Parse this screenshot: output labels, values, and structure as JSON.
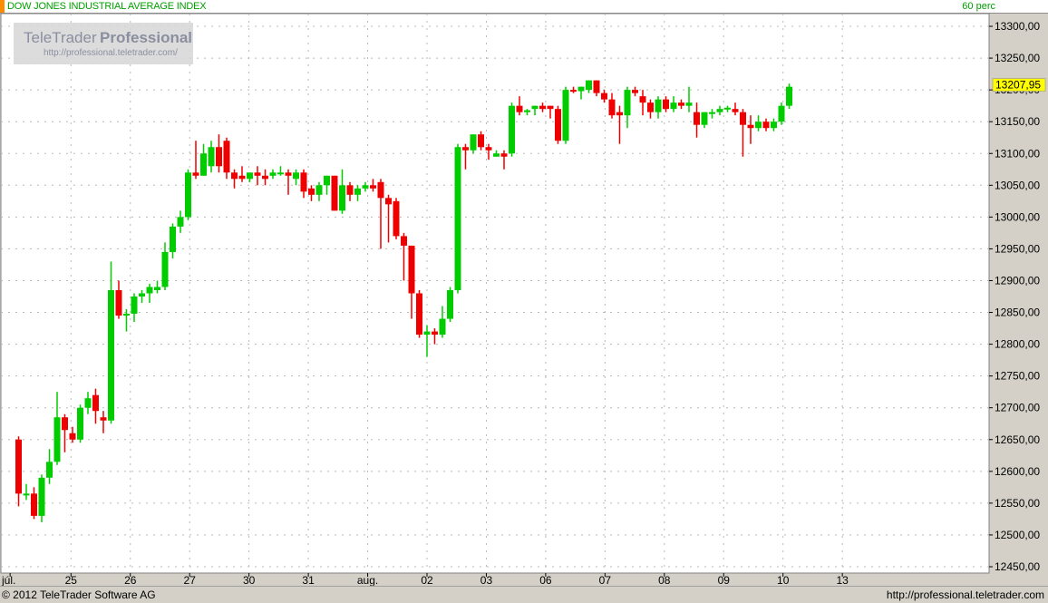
{
  "header": {
    "title": "DOW JONES INDUSTRIAL AVERAGE INDEX",
    "interval": "60 perc"
  },
  "watermark": {
    "brand_light": "TeleTrader",
    "brand_bold": "Professional",
    "url": "http://professional.teletrader.com/"
  },
  "footer": {
    "copyright": "© 2012 TeleTrader Software AG",
    "url": "http://professional.teletrader.com"
  },
  "colors": {
    "up": "#00cc00",
    "down": "#ee0000",
    "last_price_bg": "#ffff00",
    "title_text": "#00a000",
    "accent": "#ff8c00"
  },
  "chart_data": {
    "type": "candlestick",
    "title": "DOW JONES INDUSTRIAL AVERAGE INDEX",
    "ylim": [
      12440,
      13320
    ],
    "y_ticks": [
      12450,
      12500,
      12550,
      12600,
      12650,
      12700,
      12750,
      12800,
      12850,
      12900,
      12950,
      13000,
      13050,
      13100,
      13150,
      13200,
      13250,
      13300
    ],
    "y_tick_labels": [
      "12450,00",
      "12500,00",
      "12550,00",
      "12600,00",
      "12650,00",
      "12700,00",
      "12750,00",
      "12800,00",
      "12850,00",
      "12900,00",
      "12950,00",
      "13000,00",
      "13050,00",
      "13100,00",
      "13150,00",
      "13200,00",
      "13250,00",
      "13300,00"
    ],
    "grid": true,
    "last_price": 13207.95,
    "last_price_label": "13207,95",
    "x_labels": [
      {
        "label": "júl.",
        "index": -1.1
      },
      {
        "label": "25",
        "index": 6.8
      },
      {
        "label": "26",
        "index": 14.5
      },
      {
        "label": "27",
        "index": 22.2
      },
      {
        "label": "30",
        "index": 29.9
      },
      {
        "label": "31",
        "index": 37.6
      },
      {
        "label": "aug.",
        "index": 45.3
      },
      {
        "label": "02",
        "index": 53.0
      },
      {
        "label": "03",
        "index": 60.7
      },
      {
        "label": "06",
        "index": 68.4
      },
      {
        "label": "07",
        "index": 76.1
      },
      {
        "label": "08",
        "index": 83.8
      },
      {
        "label": "09",
        "index": 91.5
      },
      {
        "label": "10",
        "index": 99.2
      },
      {
        "label": "13",
        "index": 106.9
      }
    ],
    "day_separators": [
      6.8,
      14.5,
      22.2,
      29.9,
      37.6,
      45.3,
      53.0,
      60.7,
      68.4,
      76.1,
      83.8,
      91.5,
      99.2,
      106.9
    ],
    "candles": [
      [
        12650,
        12655,
        12545,
        12565
      ],
      [
        12565,
        12580,
        12555,
        12565
      ],
      [
        12565,
        12575,
        12525,
        12530
      ],
      [
        12530,
        12595,
        12520,
        12590
      ],
      [
        12590,
        12635,
        12580,
        12615
      ],
      [
        12615,
        12725,
        12610,
        12685
      ],
      [
        12685,
        12690,
        12630,
        12665
      ],
      [
        12660,
        12670,
        12645,
        12650
      ],
      [
        12650,
        12705,
        12645,
        12700
      ],
      [
        12700,
        12725,
        12690,
        12715
      ],
      [
        12720,
        12730,
        12675,
        12695
      ],
      [
        12685,
        12695,
        12660,
        12680
      ],
      [
        12680,
        12930,
        12675,
        12885
      ],
      [
        12885,
        12900,
        12840,
        12845
      ],
      [
        12845,
        12855,
        12820,
        12848
      ],
      [
        12848,
        12880,
        12835,
        12875
      ],
      [
        12875,
        12885,
        12865,
        12880
      ],
      [
        12880,
        12895,
        12865,
        12890
      ],
      [
        12885,
        12900,
        12880,
        12890
      ],
      [
        12890,
        12960,
        12885,
        12945
      ],
      [
        12945,
        12990,
        12935,
        12985
      ],
      [
        12985,
        13010,
        12975,
        13000
      ],
      [
        13000,
        13075,
        12995,
        13070
      ],
      [
        13070,
        13120,
        13060,
        13065
      ],
      [
        13065,
        13115,
        13065,
        13100
      ],
      [
        13080,
        13120,
        13070,
        13110
      ],
      [
        13110,
        13130,
        13070,
        13080
      ],
      [
        13120,
        13125,
        13060,
        13070
      ],
      [
        13070,
        13075,
        13045,
        13060
      ],
      [
        13065,
        13080,
        13055,
        13060
      ],
      [
        13060,
        13070,
        13055,
        13070
      ],
      [
        13070,
        13080,
        13050,
        13065
      ],
      [
        13065,
        13075,
        13050,
        13060
      ],
      [
        13065,
        13075,
        13060,
        13070
      ],
      [
        13070,
        13080,
        13065,
        13070
      ],
      [
        13070,
        13075,
        13035,
        13065
      ],
      [
        13060,
        13075,
        13050,
        13070
      ],
      [
        13070,
        13075,
        13030,
        13040
      ],
      [
        13045,
        13050,
        13025,
        13035
      ],
      [
        13035,
        13055,
        13025,
        13050
      ],
      [
        13050,
        13065,
        13035,
        13065
      ],
      [
        13065,
        13065,
        13010,
        13010
      ],
      [
        13010,
        13075,
        13005,
        13050
      ],
      [
        13050,
        13055,
        13025,
        13035
      ],
      [
        13035,
        13050,
        13025,
        13045
      ],
      [
        13045,
        13055,
        13040,
        13050
      ],
      [
        13050,
        13060,
        13040,
        13045
      ],
      [
        13055,
        13060,
        12950,
        13030
      ],
      [
        13030,
        13035,
        12960,
        13020
      ],
      [
        13025,
        13030,
        12965,
        12970
      ],
      [
        12970,
        12975,
        12900,
        12955
      ],
      [
        12955,
        12955,
        12840,
        12880
      ],
      [
        12880,
        12885,
        12810,
        12815
      ],
      [
        12815,
        12830,
        12780,
        12820
      ],
      [
        12820,
        12825,
        12800,
        12815
      ],
      [
        12815,
        12860,
        12810,
        12840
      ],
      [
        12840,
        12890,
        12835,
        12885
      ],
      [
        12885,
        13115,
        12880,
        13110
      ],
      [
        13110,
        13115,
        13075,
        13105
      ],
      [
        13105,
        13130,
        13100,
        13130
      ],
      [
        13130,
        13135,
        13105,
        13110
      ],
      [
        13110,
        13115,
        13090,
        13105
      ],
      [
        13095,
        13105,
        13095,
        13100
      ],
      [
        13100,
        13105,
        13075,
        13095
      ],
      [
        13100,
        13180,
        13095,
        13175
      ],
      [
        13175,
        13190,
        13160,
        13165
      ],
      [
        13165,
        13170,
        13160,
        13168
      ],
      [
        13170,
        13175,
        13160,
        13175
      ],
      [
        13175,
        13180,
        13165,
        13170
      ],
      [
        13175,
        13175,
        13155,
        13170
      ],
      [
        13170,
        13175,
        13115,
        13120
      ],
      [
        13120,
        13205,
        13115,
        13200
      ],
      [
        13200,
        13205,
        13195,
        13198
      ],
      [
        13198,
        13205,
        13185,
        13205
      ],
      [
        13200,
        13215,
        13195,
        13215
      ],
      [
        13215,
        13215,
        13190,
        13195
      ],
      [
        13195,
        13200,
        13180,
        13185
      ],
      [
        13185,
        13195,
        13155,
        13160
      ],
      [
        13165,
        13175,
        13115,
        13160
      ],
      [
        13160,
        13205,
        13140,
        13200
      ],
      [
        13200,
        13205,
        13190,
        13195
      ],
      [
        13190,
        13200,
        13160,
        13180
      ],
      [
        13180,
        13185,
        13155,
        13165
      ],
      [
        13165,
        13190,
        13155,
        13185
      ],
      [
        13185,
        13190,
        13165,
        13170
      ],
      [
        13170,
        13190,
        13165,
        13180
      ],
      [
        13180,
        13185,
        13170,
        13175
      ],
      [
        13175,
        13205,
        13165,
        13180
      ],
      [
        13165,
        13180,
        13125,
        13145
      ],
      [
        13145,
        13165,
        13140,
        13165
      ],
      [
        13165,
        13170,
        13155,
        13165
      ],
      [
        13165,
        13175,
        13160,
        13170
      ],
      [
        13170,
        13175,
        13165,
        13172
      ],
      [
        13170,
        13180,
        13160,
        13165
      ],
      [
        13165,
        13170,
        13095,
        13145
      ],
      [
        13145,
        13160,
        13115,
        13140
      ],
      [
        13140,
        13160,
        13135,
        13150
      ],
      [
        13150,
        13155,
        13135,
        13140
      ],
      [
        13140,
        13155,
        13135,
        13150
      ],
      [
        13150,
        13180,
        13145,
        13175
      ],
      [
        13175,
        13210,
        13170,
        13205
      ]
    ]
  }
}
